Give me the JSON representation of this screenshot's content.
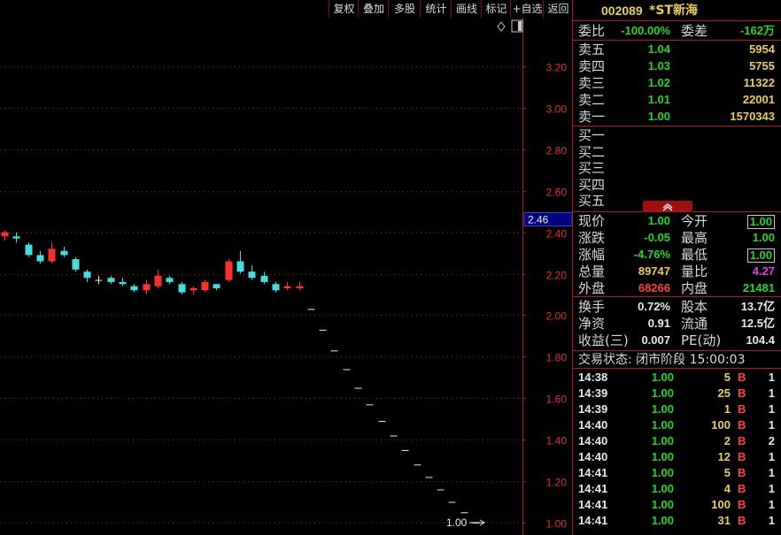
{
  "toolbar": {
    "buttons": [
      "复权",
      "叠加",
      "多股",
      "统计",
      "画线",
      "标记",
      "+自选",
      "返回"
    ]
  },
  "stock": {
    "code": "002089",
    "name": "*ST新海"
  },
  "order_ratio": {
    "label1": "委比",
    "value1": "-100.00%",
    "label2": "委差",
    "value2": "-162万"
  },
  "asks": [
    {
      "label": "卖五",
      "price": "1.04",
      "volume": "5954"
    },
    {
      "label": "卖四",
      "price": "1.03",
      "volume": "5755"
    },
    {
      "label": "卖三",
      "price": "1.02",
      "volume": "11322"
    },
    {
      "label": "卖二",
      "price": "1.01",
      "volume": "22001"
    },
    {
      "label": "卖一",
      "price": "1.00",
      "volume": "1570343"
    }
  ],
  "bids": [
    {
      "label": "买一"
    },
    {
      "label": "买二"
    },
    {
      "label": "买三"
    },
    {
      "label": "买四"
    },
    {
      "label": "买五"
    }
  ],
  "quote": {
    "rows": [
      {
        "l1": "现价",
        "v1": "1.00",
        "l2": "今开",
        "v2": "1.00"
      },
      {
        "l1": "涨跌",
        "v1": "-0.05",
        "l2": "最高",
        "v2": "1.00"
      },
      {
        "l1": "涨幅",
        "v1": "-4.76%",
        "l2": "最低",
        "v2": "1.00"
      },
      {
        "l1": "总量",
        "v1": "89747",
        "l2": "量比",
        "v2": "4.27"
      },
      {
        "l1": "外盘",
        "v1": "68266",
        "l2": "内盘",
        "v2": "21481"
      }
    ]
  },
  "fundamentals": {
    "rows": [
      {
        "l1": "换手",
        "v1": "0.72%",
        "l2": "股本",
        "v2": "13.7亿"
      },
      {
        "l1": "净资",
        "v1": "0.91",
        "l2": "流通",
        "v2": "12.5亿"
      },
      {
        "l1": "收益(三)",
        "v1": "0.007",
        "l2": "PE(动)",
        "v2": "104.4"
      }
    ]
  },
  "trade_status": "交易状态: 闭市阶段 15:00:03",
  "ticks": [
    {
      "time": "14:38",
      "price": "1.00",
      "vol": "5",
      "side": "B",
      "count": "1"
    },
    {
      "time": "14:39",
      "price": "1.00",
      "vol": "25",
      "side": "B",
      "count": "1"
    },
    {
      "time": "14:39",
      "price": "1.00",
      "vol": "1",
      "side": "B",
      "count": "1"
    },
    {
      "time": "14:40",
      "price": "1.00",
      "vol": "100",
      "side": "B",
      "count": "1"
    },
    {
      "time": "14:40",
      "price": "1.00",
      "vol": "2",
      "side": "B",
      "count": "2"
    },
    {
      "time": "14:40",
      "price": "1.00",
      "vol": "12",
      "side": "B",
      "count": "1"
    },
    {
      "time": "14:41",
      "price": "1.00",
      "vol": "5",
      "side": "B",
      "count": "1"
    },
    {
      "time": "14:41",
      "price": "1.00",
      "vol": "4",
      "side": "B",
      "count": "1"
    },
    {
      "time": "14:41",
      "price": "1.00",
      "vol": "100",
      "side": "B",
      "count": "1"
    },
    {
      "time": "14:41",
      "price": "1.00",
      "vol": "31",
      "side": "B",
      "count": "1"
    }
  ],
  "chart_data": {
    "type": "candlestick",
    "yticks": [
      "3.20",
      "3.00",
      "2.80",
      "2.60",
      "2.40",
      "2.20",
      "2.00",
      "1.80",
      "1.60",
      "1.40",
      "1.20",
      "1.00"
    ],
    "ylim": [
      0.94,
      3.4
    ],
    "current_price_tag": "2.46",
    "last_price_label": "1.00",
    "colors": {
      "up": "#ff3030",
      "down": "#40e0e0",
      "flat": "#e8e8e8",
      "grid": "#a01818",
      "axis": "#b01818"
    },
    "candles": [
      [
        2.38,
        2.4,
        2.41,
        2.36
      ],
      [
        2.38,
        2.37,
        2.4,
        2.35
      ],
      [
        2.34,
        2.29,
        2.35,
        2.28
      ],
      [
        2.29,
        2.26,
        2.31,
        2.25
      ],
      [
        2.26,
        2.32,
        2.35,
        2.25
      ],
      [
        2.31,
        2.29,
        2.33,
        2.28
      ],
      [
        2.27,
        2.22,
        2.28,
        2.21
      ],
      [
        2.21,
        2.18,
        2.22,
        2.16
      ],
      [
        2.17,
        2.17,
        2.19,
        2.15
      ],
      [
        2.18,
        2.16,
        2.19,
        2.15
      ],
      [
        2.16,
        2.15,
        2.18,
        2.14
      ],
      [
        2.14,
        2.12,
        2.15,
        2.11
      ],
      [
        2.12,
        2.15,
        2.17,
        2.1
      ],
      [
        2.14,
        2.19,
        2.22,
        2.13
      ],
      [
        2.18,
        2.16,
        2.19,
        2.15
      ],
      [
        2.15,
        2.11,
        2.16,
        2.1
      ],
      [
        2.12,
        2.13,
        2.14,
        2.1
      ],
      [
        2.12,
        2.16,
        2.17,
        2.11
      ],
      [
        2.15,
        2.13,
        2.15,
        2.12
      ],
      [
        2.17,
        2.26,
        2.27,
        2.16
      ],
      [
        2.26,
        2.21,
        2.31,
        2.2
      ],
      [
        2.21,
        2.18,
        2.24,
        2.17
      ],
      [
        2.19,
        2.16,
        2.21,
        2.15
      ],
      [
        2.15,
        2.12,
        2.16,
        2.11
      ],
      [
        2.13,
        2.14,
        2.16,
        2.12
      ],
      [
        2.13,
        2.14,
        2.16,
        2.12
      ],
      [
        2.03,
        2.03,
        2.03,
        2.03
      ],
      [
        1.93,
        1.93,
        1.93,
        1.93
      ],
      [
        1.83,
        1.83,
        1.83,
        1.83
      ],
      [
        1.74,
        1.74,
        1.74,
        1.74
      ],
      [
        1.65,
        1.65,
        1.65,
        1.65
      ],
      [
        1.57,
        1.57,
        1.57,
        1.57
      ],
      [
        1.49,
        1.49,
        1.49,
        1.49
      ],
      [
        1.42,
        1.42,
        1.42,
        1.42
      ],
      [
        1.35,
        1.35,
        1.35,
        1.35
      ],
      [
        1.28,
        1.28,
        1.28,
        1.28
      ],
      [
        1.22,
        1.22,
        1.22,
        1.22
      ],
      [
        1.16,
        1.16,
        1.16,
        1.16
      ],
      [
        1.1,
        1.1,
        1.1,
        1.1
      ],
      [
        1.05,
        1.05,
        1.05,
        1.05
      ],
      [
        1.0,
        1.0,
        1.0,
        1.0
      ]
    ]
  }
}
